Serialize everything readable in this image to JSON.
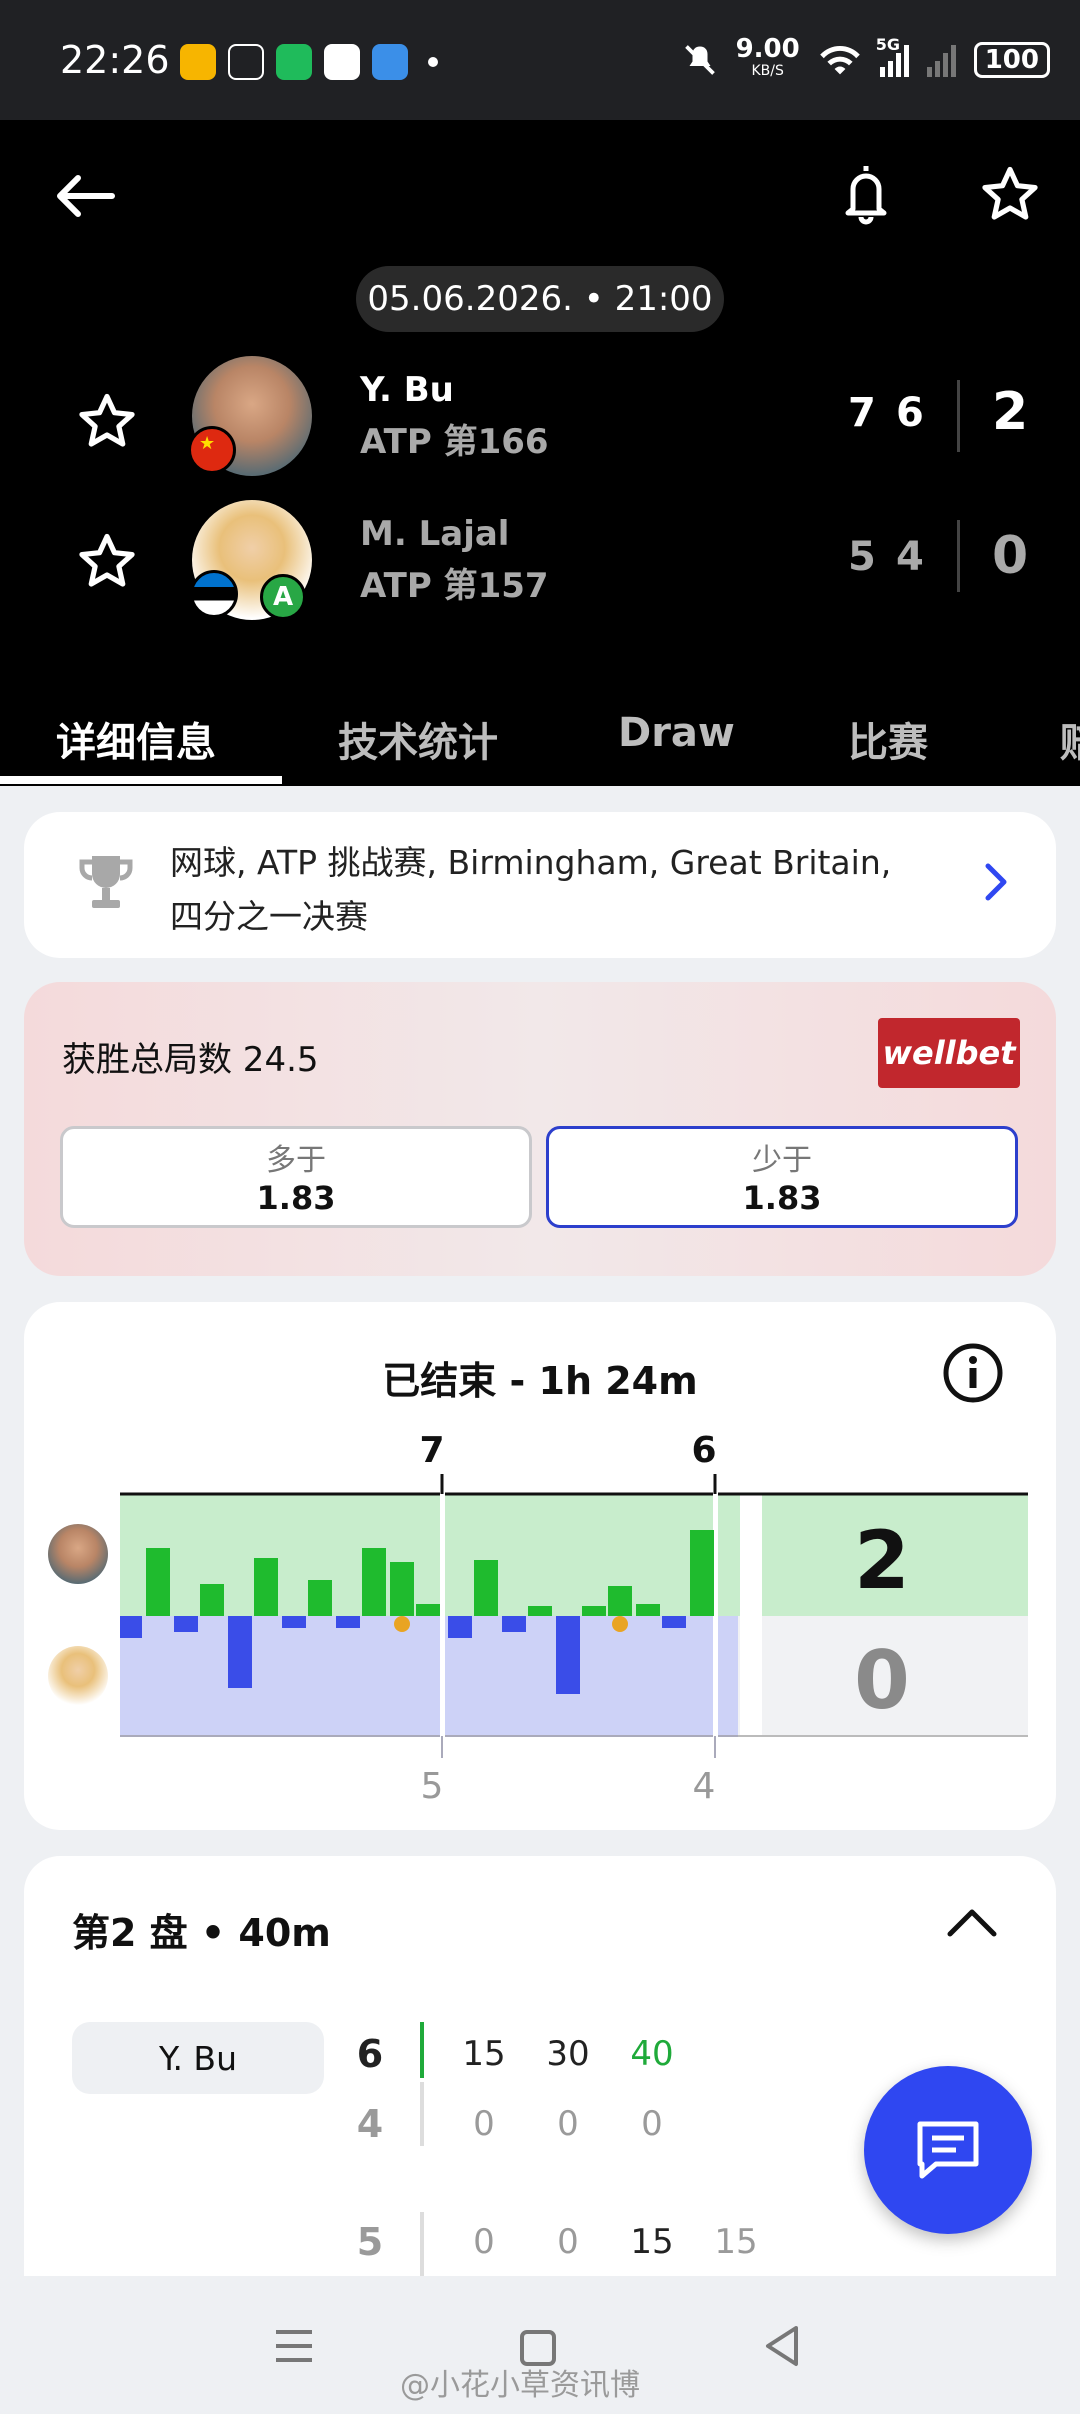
{
  "status_bar": {
    "time": "22:26",
    "net_speed_value": "9.00",
    "net_speed_unit": "KB/S",
    "mobile": "5G",
    "battery": "100"
  },
  "header": {
    "datetime": "05.06.2026. • 21:00",
    "players": [
      {
        "name": "Y. Bu",
        "rank": "ATP 第166",
        "sets": [
          "7",
          "6"
        ],
        "total": "2",
        "flag": "china"
      },
      {
        "name": "M. Lajal",
        "rank": "ATP 第157",
        "sets": [
          "5",
          "4"
        ],
        "total": "0",
        "flag": "estonia",
        "badge": "A"
      }
    ],
    "tabs": [
      "详细信息",
      "技术统计",
      "Draw",
      "比赛",
      "赔"
    ]
  },
  "tournament": {
    "line1": "网球, ATP 挑战赛, Birmingham, Great Britain,",
    "line2": "四分之一决赛"
  },
  "bet": {
    "title": "获胜总局数 24.5",
    "brand": "wellbet",
    "options": [
      {
        "label": "多于",
        "value": "1.83"
      },
      {
        "label": "少于",
        "value": "1.83"
      }
    ]
  },
  "momentum": {
    "title": "已结束 - 1h 24m",
    "set_top": [
      "7",
      "6"
    ],
    "set_bottom": [
      "5",
      "4"
    ],
    "total_top": "2",
    "total_bottom": "0",
    "colors": {
      "top": "#1fbb2e",
      "bottom": "#3a4de8",
      "top_bg": "#c8edcc",
      "bottom_bg": "#cdd2f7"
    }
  },
  "set2": {
    "title": "第2 盘 • 40m",
    "player_label": "Y. Bu",
    "row1": {
      "games_top": "6",
      "games_bottom": "4",
      "points_top": [
        "15",
        "30",
        "40"
      ],
      "points_bottom": [
        "0",
        "0",
        "0"
      ]
    },
    "row2": {
      "games": "5",
      "points": [
        "0",
        "0",
        "15",
        "15"
      ]
    }
  },
  "watermark": "@小花小草资讯博"
}
